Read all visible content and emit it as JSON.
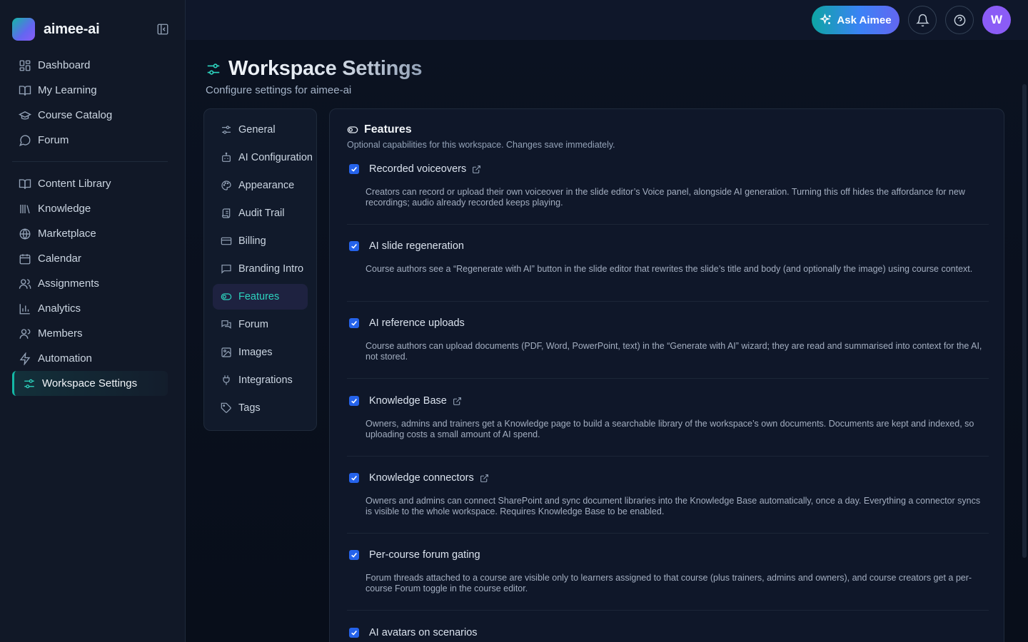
{
  "brand": {
    "name": "aimee-ai"
  },
  "sidebar": {
    "primary": [
      {
        "label": "Dashboard",
        "icon": "grid-icon"
      },
      {
        "label": "My Learning",
        "icon": "book-open-icon"
      },
      {
        "label": "Course Catalog",
        "icon": "graduation-cap-icon"
      },
      {
        "label": "Forum",
        "icon": "message-circle-icon"
      }
    ],
    "secondary": [
      {
        "label": "Content Library",
        "icon": "book-open-icon"
      },
      {
        "label": "Knowledge",
        "icon": "library-icon"
      },
      {
        "label": "Marketplace",
        "icon": "globe-icon"
      },
      {
        "label": "Calendar",
        "icon": "calendar-icon"
      },
      {
        "label": "Assignments",
        "icon": "users-icon"
      },
      {
        "label": "Analytics",
        "icon": "bar-chart-icon"
      },
      {
        "label": "Members",
        "icon": "user-icon"
      },
      {
        "label": "Automation",
        "icon": "zap-icon"
      },
      {
        "label": "Workspace Settings",
        "icon": "sliders-icon",
        "active": true
      }
    ]
  },
  "topbar": {
    "ask_label": "Ask Aimee",
    "avatar_initial": "W"
  },
  "page": {
    "title": "Workspace Settings",
    "subtitle": "Configure settings for aimee-ai"
  },
  "settings_nav": [
    {
      "label": "General",
      "icon": "sliders-icon"
    },
    {
      "label": "AI Configuration",
      "icon": "bot-icon"
    },
    {
      "label": "Appearance",
      "icon": "palette-icon"
    },
    {
      "label": "Audit Trail",
      "icon": "scroll-icon"
    },
    {
      "label": "Billing",
      "icon": "credit-card-icon"
    },
    {
      "label": "Branding Intro",
      "icon": "presentation-icon"
    },
    {
      "label": "Features",
      "icon": "toggle-icon",
      "active": true
    },
    {
      "label": "Forum",
      "icon": "messages-icon"
    },
    {
      "label": "Images",
      "icon": "image-icon"
    },
    {
      "label": "Integrations",
      "icon": "plug-icon"
    },
    {
      "label": "Tags",
      "icon": "tag-icon"
    }
  ],
  "features_panel": {
    "title": "Features",
    "description": "Optional capabilities for this workspace. Changes save immediately.",
    "items": [
      {
        "label": "Recorded voiceovers",
        "checked": true,
        "external_link": true,
        "description": "Creators can record or upload their own voiceover in the slide editor’s Voice panel, alongside AI generation. Turning this off hides the affordance for new recordings; audio already recorded keeps playing."
      },
      {
        "label": "AI slide regeneration",
        "checked": true,
        "external_link": false,
        "description": "Course authors see a “Regenerate with AI” button in the slide editor that rewrites the slide’s title and body (and optionally the image) using course context."
      },
      {
        "label": "AI reference uploads",
        "checked": true,
        "external_link": false,
        "description": "Course authors can upload documents (PDF, Word, PowerPoint, text) in the “Generate with AI” wizard; they are read and summarised into context for the AI, not stored."
      },
      {
        "label": "Knowledge Base",
        "checked": true,
        "external_link": true,
        "description": "Owners, admins and trainers get a Knowledge page to build a searchable library of the workspace’s own documents. Documents are kept and indexed, so uploading costs a small amount of AI spend."
      },
      {
        "label": "Knowledge connectors",
        "checked": true,
        "external_link": true,
        "description": "Owners and admins can connect SharePoint and sync document libraries into the Knowledge Base automatically, once a day. Everything a connector syncs is visible to the whole workspace. Requires Knowledge Base to be enabled."
      },
      {
        "label": "Per-course forum gating",
        "checked": true,
        "external_link": false,
        "description": "Forum threads attached to a course are visible only to learners assigned to that course (plus trainers, admins and owners), and course creators get a per-course Forum toggle in the course editor."
      },
      {
        "label": "AI avatars on scenarios",
        "checked": true,
        "external_link": false,
        "description": ""
      }
    ]
  }
}
